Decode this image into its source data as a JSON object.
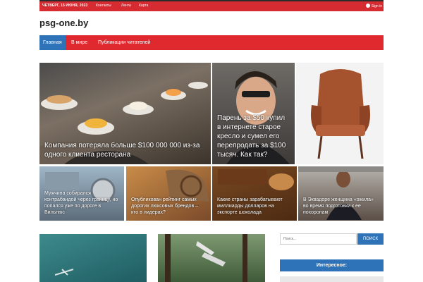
{
  "topbar": {
    "date": "ЧЕТВЕРГ, 15 ИЮНЯ, 2023",
    "links": [
      "Контакты",
      "Лента",
      "Карта"
    ],
    "signin": "Sign in"
  },
  "site": {
    "logo": "psg-one.by"
  },
  "nav": {
    "items": [
      "Главная",
      "В мире",
      "Публикации читателей"
    ],
    "active": "Главная"
  },
  "featured": {
    "big": [
      {
        "caption": "Компания потеряла больше $100 000 000 из-за одного клиента ресторана"
      },
      {
        "caption": "Парень за $50 купил в интернете старое кресло и сумел его перепродать за $100 тысяч. Как так?"
      }
    ],
    "small": [
      {
        "caption": "Мужчина собирался контрабандой через границу, но попался уже по дороге в Вильнюс"
      },
      {
        "caption": "Опубликован рейтинг самых дорогих люксовых брендов – кто в лидерах?"
      },
      {
        "caption": "Какие страны зарабатывают миллиарды долларов на экспорте шоколада"
      },
      {
        "caption": "В Эквадоре женщина «ожила» во время подготовки к ее похоронам"
      }
    ]
  },
  "sidebar": {
    "search_placeholder": "Поиск...",
    "search_button": "ПОИСК",
    "widget_title": "Интересное:"
  },
  "colors": {
    "accent_red": "#e0282f",
    "accent_blue": "#2e72b8"
  }
}
